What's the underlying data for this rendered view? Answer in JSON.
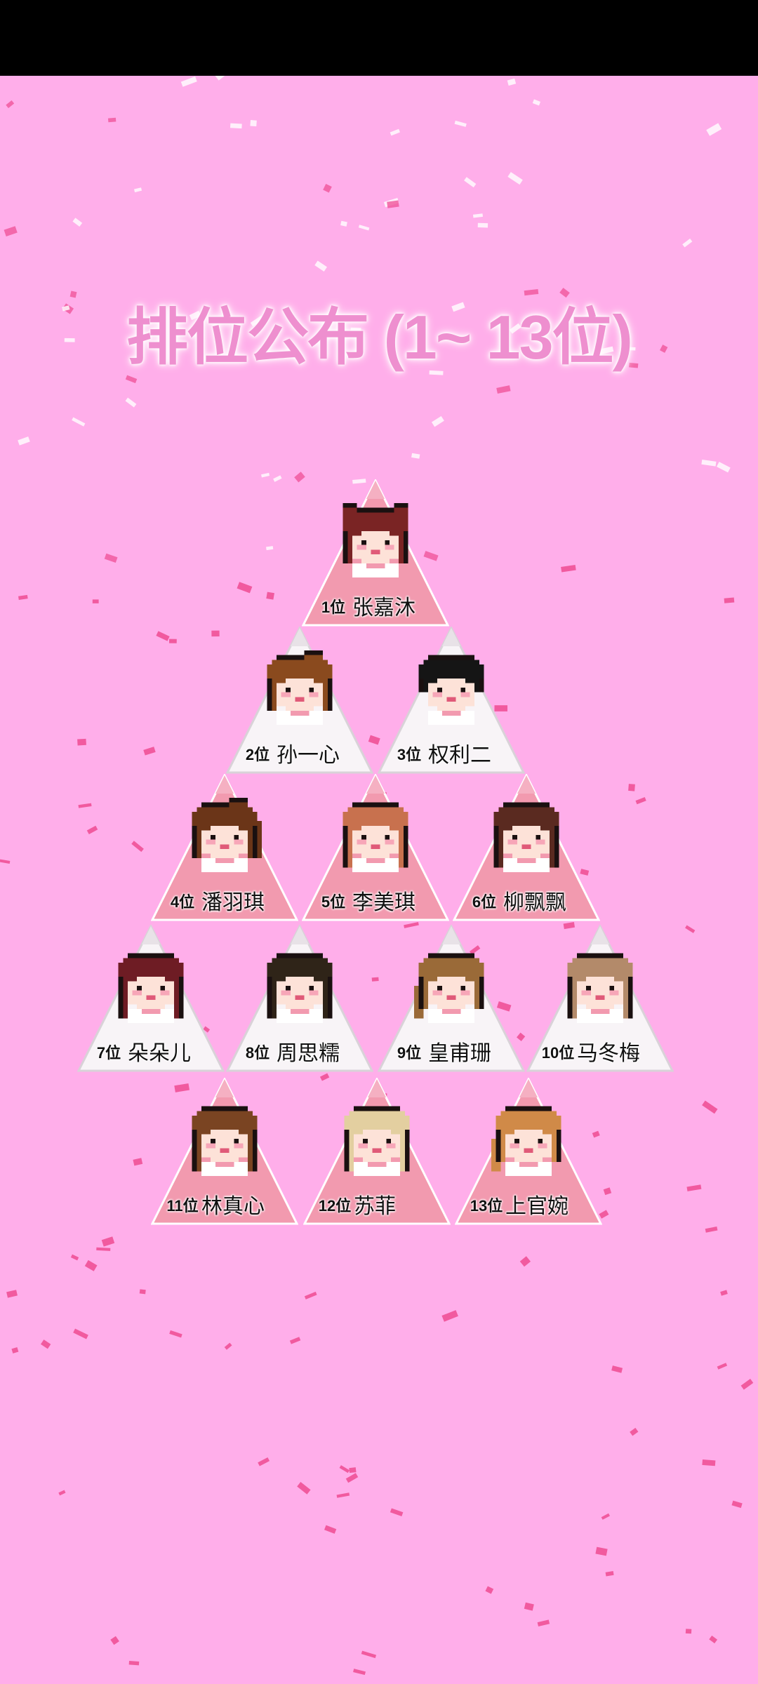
{
  "title": "排位公布 (1~ 13位)",
  "colors": {
    "background": "#ffaeea",
    "confetti": "#f0559b",
    "triangle_pink": "#f29aaf",
    "triangle_white": "#f8f4f7",
    "triangle_edge": "#d9d2d8"
  },
  "ranking": [
    {
      "rank_label": "1位",
      "name": "张嘉沐",
      "tile": "pink",
      "hair": "#7a2424",
      "style": "buns"
    },
    {
      "rank_label": "2位",
      "name": "孙一心",
      "tile": "white",
      "hair": "#8a4a1e",
      "style": "updo"
    },
    {
      "rank_label": "3位",
      "name": "权利二",
      "tile": "white",
      "hair": "#151515",
      "style": "short"
    },
    {
      "rank_label": "4位",
      "name": "潘羽琪",
      "tile": "pink",
      "hair": "#6b3518",
      "style": "ponytail"
    },
    {
      "rank_label": "5位",
      "name": "李美琪",
      "tile": "pink",
      "hair": "#c8714e",
      "style": "braids"
    },
    {
      "rank_label": "6位",
      "name": "柳飘飘",
      "tile": "pink",
      "hair": "#5a2a20",
      "style": "long"
    },
    {
      "rank_label": "7位",
      "name": "朵朵儿",
      "tile": "white",
      "hair": "#6e1c24",
      "style": "long"
    },
    {
      "rank_label": "8位",
      "name": "周思糯",
      "tile": "white",
      "hair": "#2f2418",
      "style": "straight"
    },
    {
      "rank_label": "9位",
      "name": "皇甫珊",
      "tile": "white",
      "hair": "#9a6a38",
      "style": "side"
    },
    {
      "rank_label": "10位",
      "name": "马冬梅",
      "tile": "white",
      "hair": "#b38a6a",
      "style": "wavy"
    },
    {
      "rank_label": "11位",
      "name": "林真心",
      "tile": "pink",
      "hair": "#7a4422",
      "style": "long"
    },
    {
      "rank_label": "12位",
      "name": "苏菲",
      "tile": "pink",
      "hair": "#e3cfa0",
      "style": "long"
    },
    {
      "rank_label": "13位",
      "name": "上官婉",
      "tile": "pink",
      "hair": "#d08a48",
      "style": "side"
    }
  ]
}
